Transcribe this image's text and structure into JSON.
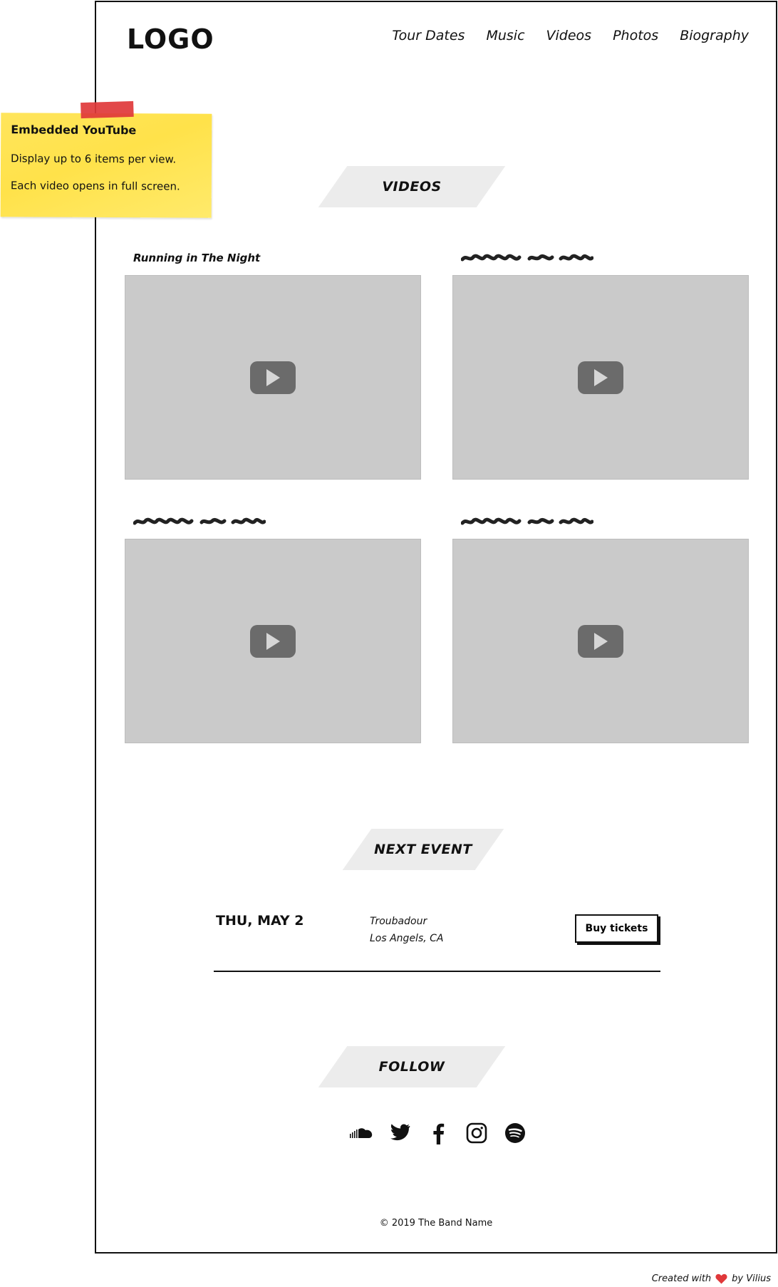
{
  "header": {
    "logo": "LOGO",
    "nav": [
      "Tour Dates",
      "Music",
      "Videos",
      "Photos",
      "Biography"
    ]
  },
  "videos_section": {
    "title": "VIDEOS",
    "items": [
      {
        "title": "Running in The Night"
      },
      {
        "title": ""
      },
      {
        "title": ""
      },
      {
        "title": ""
      }
    ]
  },
  "next_event_section": {
    "title": "NEXT EVENT",
    "date": "THU, MAY 2",
    "venue": "Troubadour",
    "city": "Los Angels, CA",
    "button_label": "Buy tickets"
  },
  "follow_section": {
    "title": "FOLLOW",
    "icons": [
      "soundcloud-icon",
      "twitter-icon",
      "facebook-icon",
      "instagram-icon",
      "spotify-icon"
    ]
  },
  "footer": {
    "copyright": "© 2019 The Band Name"
  },
  "sticky_note": {
    "title": "Embedded YouTube",
    "line1": "Display up to 6 items per view.",
    "line2": "Each video opens in full screen."
  },
  "credit": {
    "prefix": "Created with",
    "suffix": "by Vilius"
  },
  "colors": {
    "accent_red": "#e0383a",
    "sticky_yellow": "#ffe24a",
    "placeholder_gray": "#cacaca",
    "play_gray": "#6b6b6b",
    "banner_gray": "#ececec"
  }
}
